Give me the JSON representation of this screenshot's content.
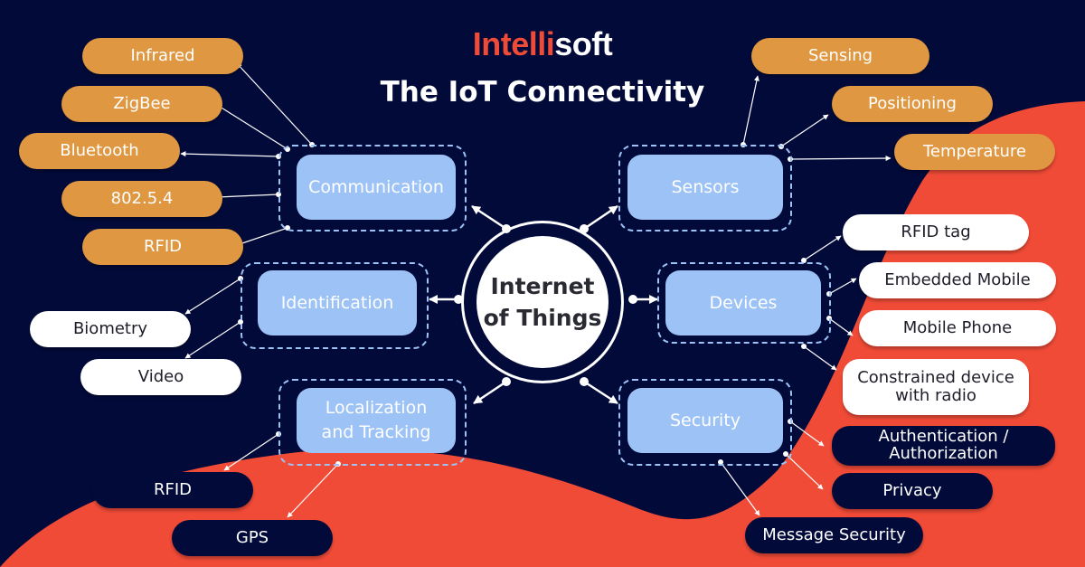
{
  "brand": {
    "name_part1": "Intelli",
    "name_part2": "soft"
  },
  "title": "The IoT Connectivity",
  "colors": {
    "background": "#020a3a",
    "accent_red": "#f04b37",
    "orange": "#e09741",
    "category_blue": "#9cc2f6",
    "white": "#ffffff"
  },
  "hub": {
    "line1": "Internet",
    "line2": "of Things"
  },
  "categories": {
    "communication": {
      "label": "Communication",
      "items": [
        "Infrared",
        "ZigBee",
        "Bluetooth",
        "802.5.4",
        "RFID"
      ]
    },
    "identification": {
      "label": "Identification",
      "items": [
        "Biometry",
        "Video"
      ]
    },
    "localization": {
      "label_line1": "Localization",
      "label_line2": "and Tracking",
      "items": [
        "RFID",
        "GPS"
      ]
    },
    "sensors": {
      "label": "Sensors",
      "items": [
        "Sensing",
        "Positioning",
        "Temperature"
      ]
    },
    "devices": {
      "label": "Devices",
      "items": [
        "RFID tag",
        "Embedded Mobile",
        "Mobile Phone"
      ],
      "item_multiline": {
        "line1": "Constrained device",
        "line2": "with radio"
      }
    },
    "security": {
      "label": "Security",
      "item_multiline": {
        "line1": "Authentication /",
        "line2": "Authorization"
      },
      "items": [
        "Privacy",
        "Message Security"
      ]
    }
  }
}
